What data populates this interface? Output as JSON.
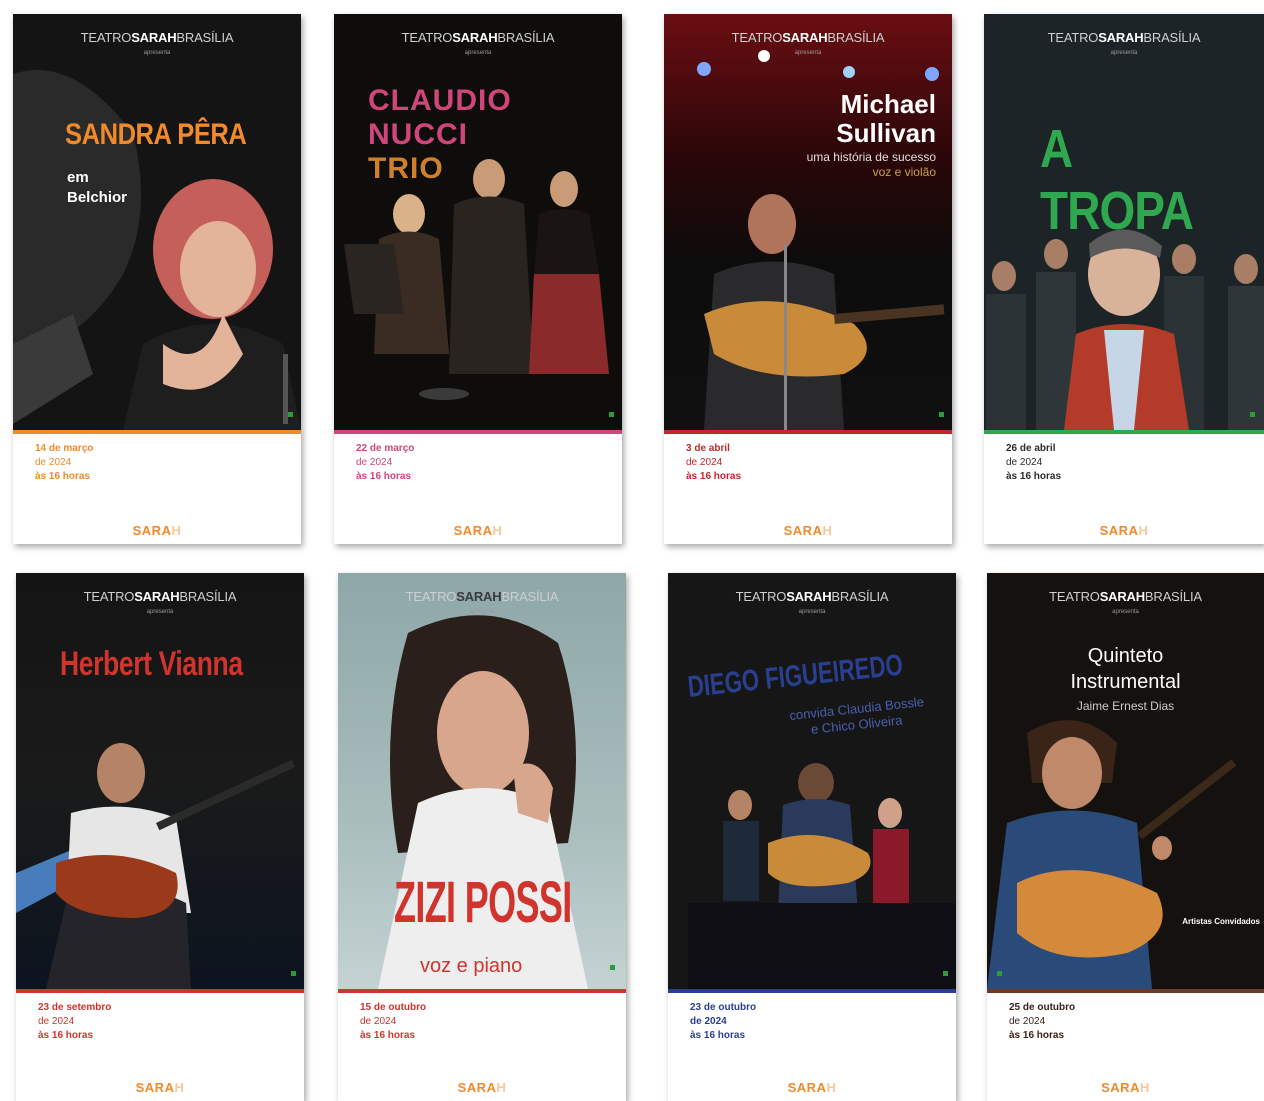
{
  "brand": {
    "header_light_1": "TEATRO",
    "header_bold": "SARAH",
    "header_light_2": "BRASÍLIA",
    "presents": "apresenta",
    "logo_main": "SARA",
    "logo_faint": "H"
  },
  "posters": [
    {
      "title_lines": [
        "SANDRA PÊRA"
      ],
      "subtitle_lines": [
        "em",
        "Belchior"
      ],
      "date": "14 de março",
      "year": "de 2024",
      "time": "às 16 horas",
      "accent": "#f08a2a"
    },
    {
      "title_lines": [
        "CLAUDIO",
        "NUCCI",
        "TRIO"
      ],
      "subtitle_lines": [],
      "date": "22 de março",
      "year": "de 2024",
      "time": "às 16 horas",
      "accent": "#d0457a"
    },
    {
      "title_lines": [
        "Michael",
        "Sullivan"
      ],
      "subtitle_lines": [
        "uma história de sucesso",
        "voz e violão"
      ],
      "date": "3 de abril",
      "year": "de 2024",
      "time": "às 16 horas",
      "accent": "#c0282d"
    },
    {
      "title_lines": [
        "A TROPA"
      ],
      "subtitle_lines": [],
      "date": "26 de abril",
      "year": "de 2024",
      "time": "às 16 horas",
      "accent": "#2fa84f"
    },
    {
      "title_lines": [
        "Herbert Vianna"
      ],
      "subtitle_lines": [],
      "date": "23 de setembro",
      "year": "de 2024",
      "time": "às 16 horas",
      "accent": "#d0342c"
    },
    {
      "title_lines": [
        "ZIZI POSSI"
      ],
      "subtitle_lines": [
        "voz e piano"
      ],
      "date": "15 de outubro",
      "year": "de 2024",
      "time": "às 16 horas",
      "accent": "#d0342c"
    },
    {
      "title_lines": [
        "DIEGO FIGUEIREDO"
      ],
      "subtitle_lines": [
        "convida Claudia Bossle",
        "e Chico Oliveira"
      ],
      "date": "23 de outubro",
      "year": "de 2024",
      "time": "às 16 horas",
      "accent": "#2a3f8f"
    },
    {
      "title_lines": [
        "Quinteto",
        "Instrumental"
      ],
      "subtitle_lines": [
        "Jaime Ernest Dias",
        "Artistas Convidados"
      ],
      "date": "25 de outubro",
      "year": "de 2024",
      "time": "às 16 horas",
      "accent": "#6a3a2a"
    }
  ]
}
